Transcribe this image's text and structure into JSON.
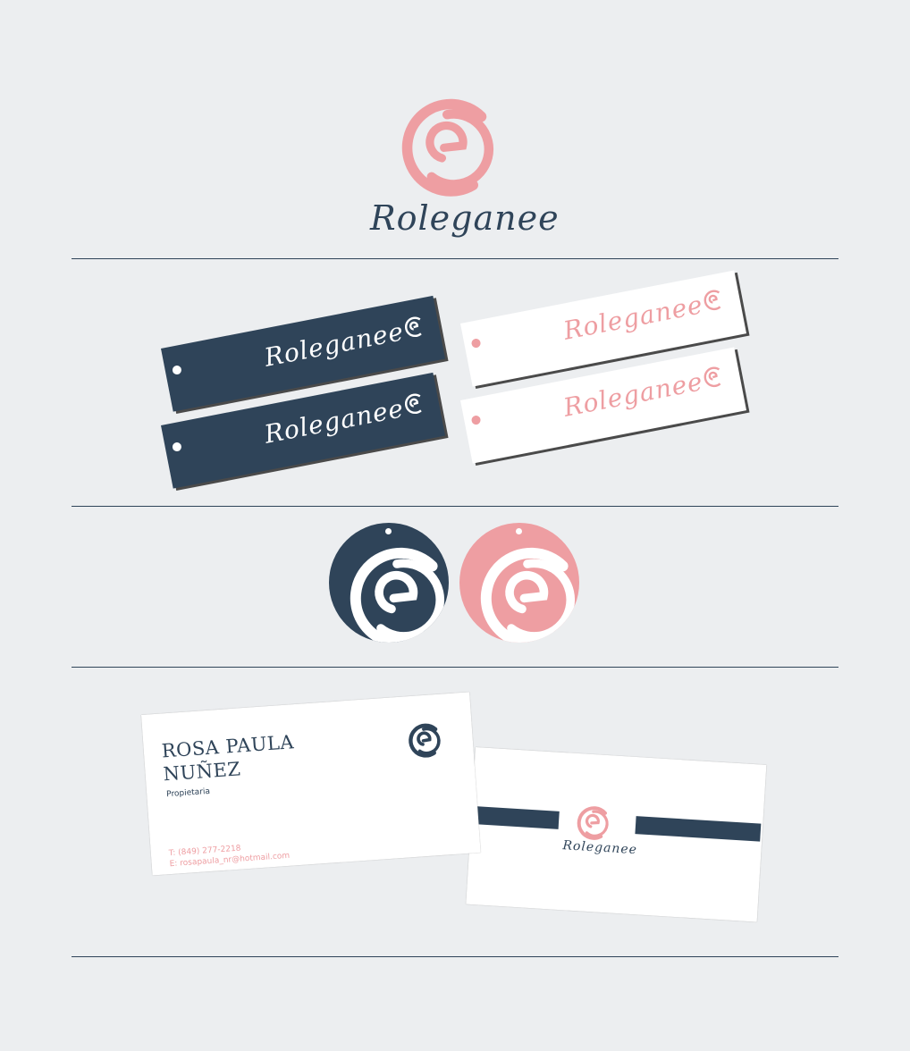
{
  "brand": {
    "name": "Roleganee",
    "colors": {
      "navy": "#2f4459",
      "pink": "#ee9ea2",
      "background": "#eceef0",
      "white": "#ffffff"
    },
    "logo_icon": "swirl-r-icon"
  },
  "business_card": {
    "name_line1": "ROSA PAULA",
    "name_line2": "NUÑEZ",
    "role": "Propietaria",
    "phone": "T: (849) 277-2218",
    "email": "E: rosapaula_nr@hotmail.com"
  }
}
